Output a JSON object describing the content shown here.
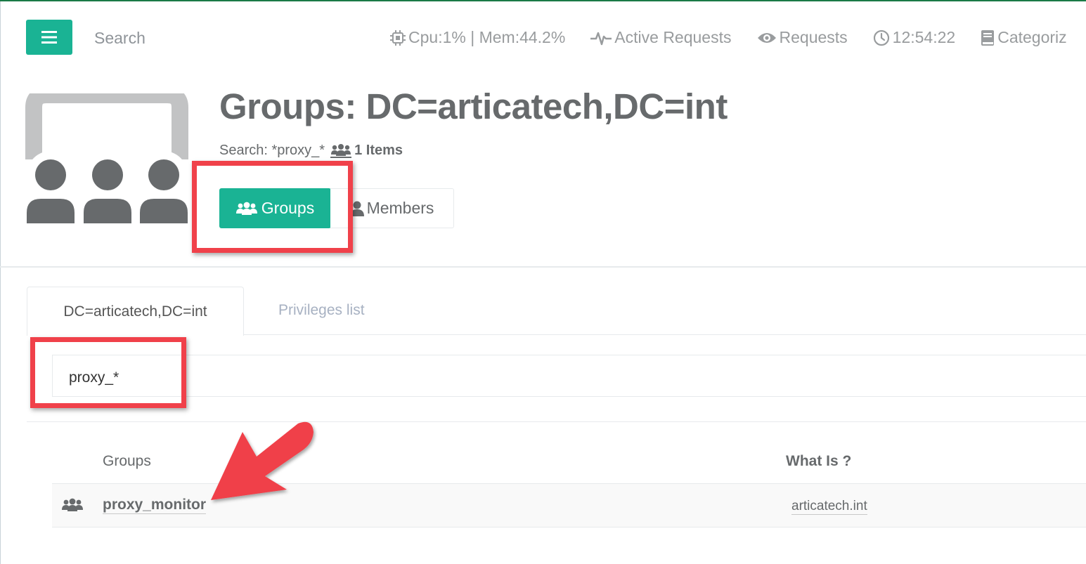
{
  "topbar": {
    "search_label": "Search",
    "cpu_mem": "Cpu:1% | Mem:44.2%",
    "active_requests": "Active Requests",
    "requests": "Requests",
    "clock": "12:54:22",
    "categories": "Categoriz"
  },
  "header": {
    "title": "Groups: DC=articatech,DC=int",
    "search_prefix": "Search: *proxy_*",
    "items_count": "1 Items",
    "groups_button": "Groups",
    "members_button": "Members"
  },
  "tabs": [
    {
      "label": "DC=articatech,DC=int",
      "active": true
    },
    {
      "label": "Privileges list",
      "active": false
    }
  ],
  "filter": {
    "value": "proxy_*"
  },
  "table": {
    "columns": [
      "Groups",
      "What Is ?"
    ],
    "rows": [
      {
        "name": "proxy_monitor",
        "domain": "articatech.int"
      }
    ]
  },
  "colors": {
    "primary": "#1ab394",
    "annotation_red": "#f0414a",
    "top_border": "#1a7a46"
  },
  "icons": {
    "menu": "hamburger-icon",
    "cpu": "chip-icon",
    "activity": "heartbeat-icon",
    "requests": "eye-icon",
    "clock": "clock-icon",
    "categories": "book-icon",
    "group": "users-icon",
    "member": "user-icon"
  }
}
